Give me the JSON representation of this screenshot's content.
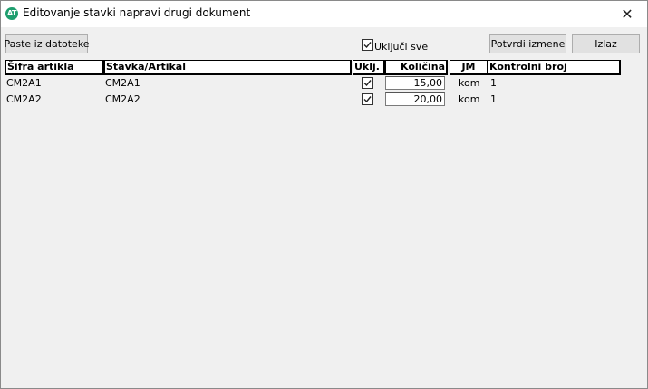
{
  "window": {
    "title": "Editovanje stavki napravi drugi dokument",
    "icon_label": "AT",
    "close_glyph": "✕"
  },
  "toolbar": {
    "paste_label": "Paste iz datoteke",
    "select_all_label": "Uključi sve",
    "select_all_checked": true,
    "confirm_label": "Potvrdi izmene",
    "exit_label": "Izlaz"
  },
  "table": {
    "columns": [
      "Šifra artikla",
      "Stavka/Artikal",
      "Uklj.",
      "Količina",
      "JM",
      "Kontrolni broj"
    ],
    "rows": [
      {
        "sifra": "CM2A1",
        "stavka": "CM2A1",
        "ukljuceno": true,
        "kolicina": "15,00",
        "jm": "kom",
        "kontrolni_broj": "1"
      },
      {
        "sifra": "CM2A2",
        "stavka": "CM2A2",
        "ukljuceno": true,
        "kolicina": "20,00",
        "jm": "kom",
        "kontrolni_broj": "1"
      }
    ]
  }
}
